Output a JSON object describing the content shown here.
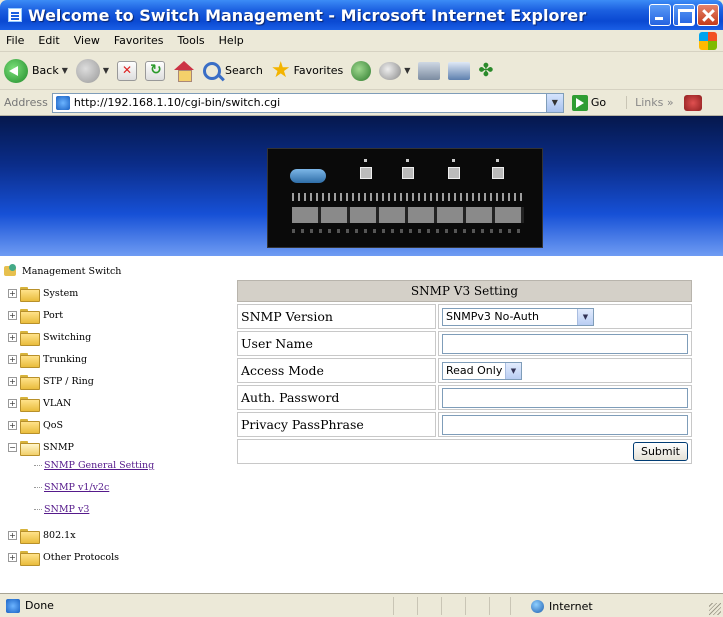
{
  "window": {
    "title": "Welcome to Switch Management - Microsoft Internet Explorer"
  },
  "menu": [
    "File",
    "Edit",
    "View",
    "Favorites",
    "Tools",
    "Help"
  ],
  "toolbar": {
    "back_label": "Back",
    "search_label": "Search",
    "favorites_label": "Favorites"
  },
  "address": {
    "label": "Address",
    "url": "http://192.168.1.10/cgi-bin/switch.cgi",
    "go_label": "Go",
    "links_label": "Links"
  },
  "tree": {
    "root": "Management Switch",
    "nodes": [
      "System",
      "Port",
      "Switching",
      "Trunking",
      "STP / Ring",
      "VLAN",
      "QoS",
      "SNMP",
      "802.1x",
      "Other Protocols"
    ],
    "snmp_children": [
      "SNMP General Setting",
      "SNMP v1/v2c",
      "SNMP v3"
    ]
  },
  "form": {
    "title": "SNMP V3 Setting",
    "rows": [
      {
        "label": "SNMP Version",
        "type": "select",
        "value": "SNMPv3 No-Auth"
      },
      {
        "label": "User Name",
        "type": "text",
        "value": ""
      },
      {
        "label": "Access Mode",
        "type": "select",
        "value": "Read Only"
      },
      {
        "label": "Auth. Password",
        "type": "text",
        "value": ""
      },
      {
        "label": "Privacy PassPhrase",
        "type": "text",
        "value": ""
      }
    ],
    "submit_label": "Submit"
  },
  "status": {
    "text": "Done",
    "zone": "Internet"
  },
  "colors": {
    "titlebar": "#0a49d2",
    "banner_top": "#05184d",
    "banner_bottom": "#6f9cf3",
    "form_header": "#d4d0c8",
    "visited_link": "#551a8b"
  }
}
